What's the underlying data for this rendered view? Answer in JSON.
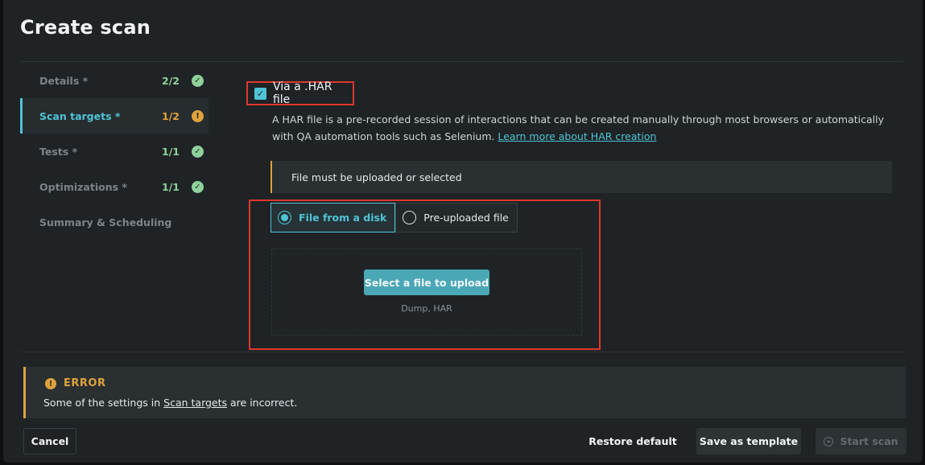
{
  "dialog": {
    "title": "Create scan"
  },
  "sidebar": {
    "steps": [
      {
        "label": "Details *",
        "count": "2/2",
        "status": "ok"
      },
      {
        "label": "Scan targets *",
        "count": "1/2",
        "status": "warn"
      },
      {
        "label": "Tests *",
        "count": "1/1",
        "status": "ok"
      },
      {
        "label": "Optimizations *",
        "count": "1/1",
        "status": "ok"
      },
      {
        "label": "Summary & Scheduling",
        "count": "",
        "status": ""
      }
    ],
    "active_index": 1
  },
  "har": {
    "checkbox_label": "Via a .HAR file",
    "checked": true,
    "description": "A HAR file is a pre-recorded session of interactions that can be created manually through most browsers or automatically with QA automation tools such as Selenium.",
    "learn_more": "Learn more about HAR creation"
  },
  "notice": {
    "text": "File must be uploaded or selected"
  },
  "source": {
    "options": [
      "File from a disk",
      "Pre-uploaded file"
    ],
    "selected": "File from a disk"
  },
  "upload": {
    "button_label": "Select a file to upload",
    "formats": "Dump, HAR"
  },
  "error": {
    "title": "ERROR",
    "message_prefix": "Some of the settings in",
    "message_link": "Scan targets",
    "message_suffix": "are incorrect."
  },
  "footer": {
    "cancel": "Cancel",
    "restore": "Restore default",
    "save_template": "Save as template",
    "start": "Start scan"
  },
  "colors": {
    "accent": "#4fc3d6",
    "warning": "#e0a33b",
    "success": "#8fd19a",
    "highlight": "#e0372d"
  }
}
